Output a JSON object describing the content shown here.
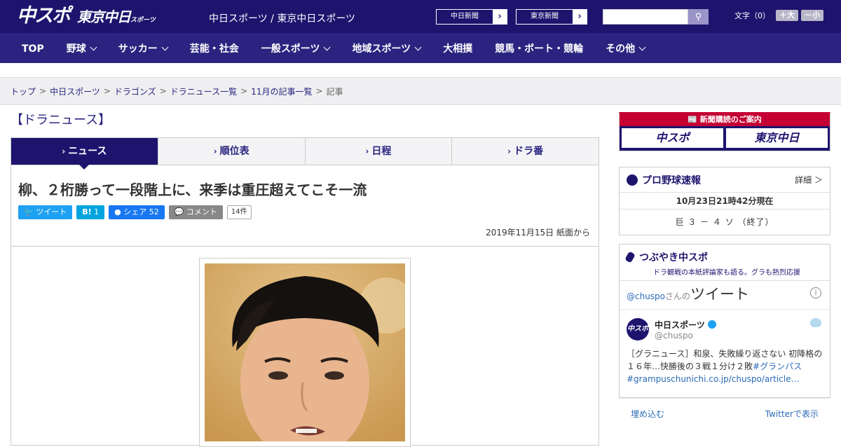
{
  "header": {
    "logo_primary": "中スポ",
    "logo_secondary": "東京中日",
    "logo_secondary_small": "スポーツ",
    "site_name": "中日スポーツ / 東京中日スポーツ",
    "paper_links": [
      {
        "label": "中日新聞"
      },
      {
        "label": "東京新聞"
      }
    ],
    "search": {
      "placeholder": ""
    },
    "font_size": {
      "label": "文字（0）",
      "increase": "＋大",
      "decrease": "－小"
    }
  },
  "nav": {
    "items": [
      {
        "label": "TOP",
        "dropdown": false
      },
      {
        "label": "野球",
        "dropdown": true
      },
      {
        "label": "サッカー",
        "dropdown": true
      },
      {
        "label": "芸能・社会",
        "dropdown": false
      },
      {
        "label": "一般スポーツ",
        "dropdown": true
      },
      {
        "label": "地域スポーツ",
        "dropdown": true
      },
      {
        "label": "大相撲",
        "dropdown": false
      },
      {
        "label": "競馬・ボート・競輪",
        "dropdown": false
      },
      {
        "label": "その他",
        "dropdown": true
      }
    ]
  },
  "breadcrumb": [
    {
      "label": "トップ",
      "link": true
    },
    {
      "label": "中日スポーツ",
      "link": true
    },
    {
      "label": "ドラゴンズ",
      "link": true
    },
    {
      "label": "ドラニュース一覧",
      "link": true
    },
    {
      "label": "11月の記事一覧",
      "link": true
    },
    {
      "label": "記事",
      "link": false
    }
  ],
  "section_title": "【ドラニュース】",
  "tabs": [
    {
      "label": "ニュース",
      "active": true
    },
    {
      "label": "順位表",
      "active": false
    },
    {
      "label": "日程",
      "active": false
    },
    {
      "label": "ドラ番",
      "active": false
    }
  ],
  "article": {
    "headline": "柳、２桁勝って一段階上に、来季は重圧超えてこそ一流",
    "share": {
      "tweet": "ツイート",
      "hatena": "B!",
      "hatena_count": "1",
      "facebook": "シェア",
      "facebook_count": "52",
      "comment": "コメント",
      "comment_count": "14件"
    },
    "date": "2019年11月15日 紙面から"
  },
  "sidebar": {
    "subscribe": {
      "banner": "新聞購読のご案内",
      "logo1": "中スポ",
      "logo2": "東京中日"
    },
    "baseball": {
      "title": "プロ野球速報",
      "detail": "詳細 ＞",
      "timestamp": "10月23日21時42分現在",
      "score": "巨 ３ － ４ ソ （終了）"
    },
    "tsubuyaki": {
      "title": "つぶやき中スポ",
      "subtitle": "ドラ観戦の本紙評論家も語る。グラも熱烈応援",
      "handle": "@chuspo",
      "san": "さんの",
      "tweet_word": "ツイート",
      "account_name": "中日スポーツ",
      "account_id": "@chuspo",
      "avatar_text": "中スポ",
      "tweet_text": "［グラニュース］和泉、失敗繰り返さない 初降格の１６年…快勝後の３戦１分け２敗",
      "tweet_hashtag": "#グランパス",
      "tweet_link": "#grampuschunichi.co.jp/chuspo/article…",
      "embed": "埋め込む",
      "view_on_twitter": "Twitterで表示"
    }
  }
}
